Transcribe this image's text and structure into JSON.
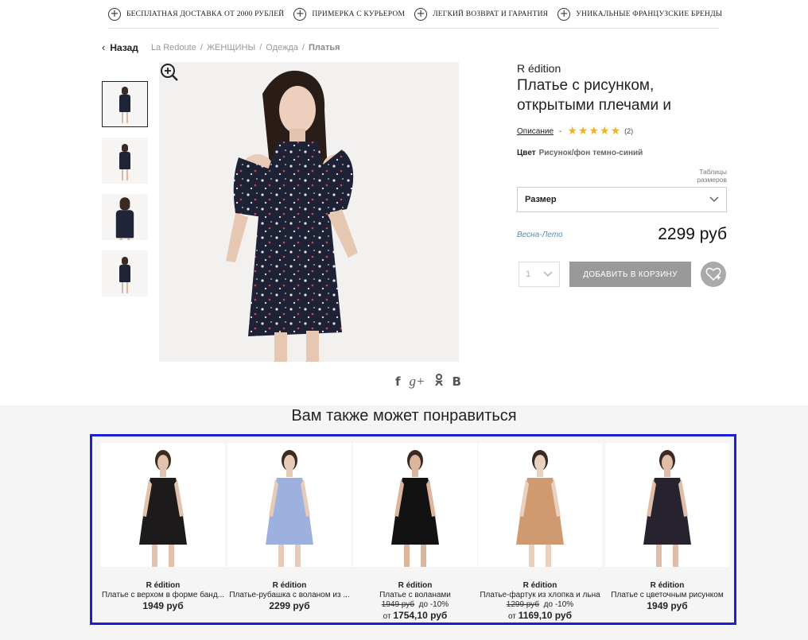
{
  "benefits": [
    "БЕСПЛАТНАЯ ДОСТАВКА ОТ 2000 РУБЛЕЙ",
    "ПРИМЕРКА С КУРЬЕРОМ",
    "ЛЕГКИЙ ВОЗВРАТ И ГАРАНТИЯ",
    "УНИКАЛЬНЫЕ ФРАНЦУЗСКИЕ БРЕНДЫ"
  ],
  "breadcrumb": {
    "back": "Назад",
    "items": [
      "La Redoute",
      "ЖЕНЩИНЫ",
      "Одежда",
      "Платья"
    ]
  },
  "product": {
    "brand": "R édition",
    "title": "Платье с рисунком, открытыми плечами и",
    "description_link": "Описание",
    "rating": 5,
    "rating_count": "(2)",
    "color_label": "Цвет",
    "color_value": "Рисунок/фон темно-синий",
    "size_table": "Таблицы размеров",
    "size_placeholder": "Размер",
    "season": "Весна-Лето",
    "price": "2299 руб",
    "qty": "1",
    "add_to_cart": "ДОБАВИТЬ В КОРЗИНУ"
  },
  "share": [
    "f",
    "g+",
    "ok",
    "B"
  ],
  "recommendations": {
    "title": "Вам также может понравиться",
    "items": [
      {
        "brand": "R édition",
        "name": "Платье с верхом в форме банд...",
        "price": "1949 руб",
        "dress_color": "#1c1a1a",
        "skin": "#e3c2ad"
      },
      {
        "brand": "R édition",
        "name": "Платье-рубашка с воланом из ...",
        "price": "2299 руб",
        "dress_color": "#9db1de",
        "skin": "#e7cbb8"
      },
      {
        "brand": "R édition",
        "name": "Платье с воланами",
        "old_price": "1949 руб",
        "discount": "до -10%",
        "from": "от",
        "from_price": "1754,10 руб",
        "dress_color": "#121212",
        "skin": "#dbb59c"
      },
      {
        "brand": "R édition",
        "name": "Платье-фартук из хлопка и льна",
        "old_price": "1299 руб",
        "discount": "до -10%",
        "from": "от",
        "from_price": "1169,10 руб",
        "dress_color": "#cf9a70",
        "skin": "#ead1bf"
      },
      {
        "brand": "R édition",
        "name": "Платье с цветочным рисунком",
        "price": "1949 руб",
        "dress_color": "#27232e",
        "skin": "#dfbda6"
      }
    ]
  }
}
